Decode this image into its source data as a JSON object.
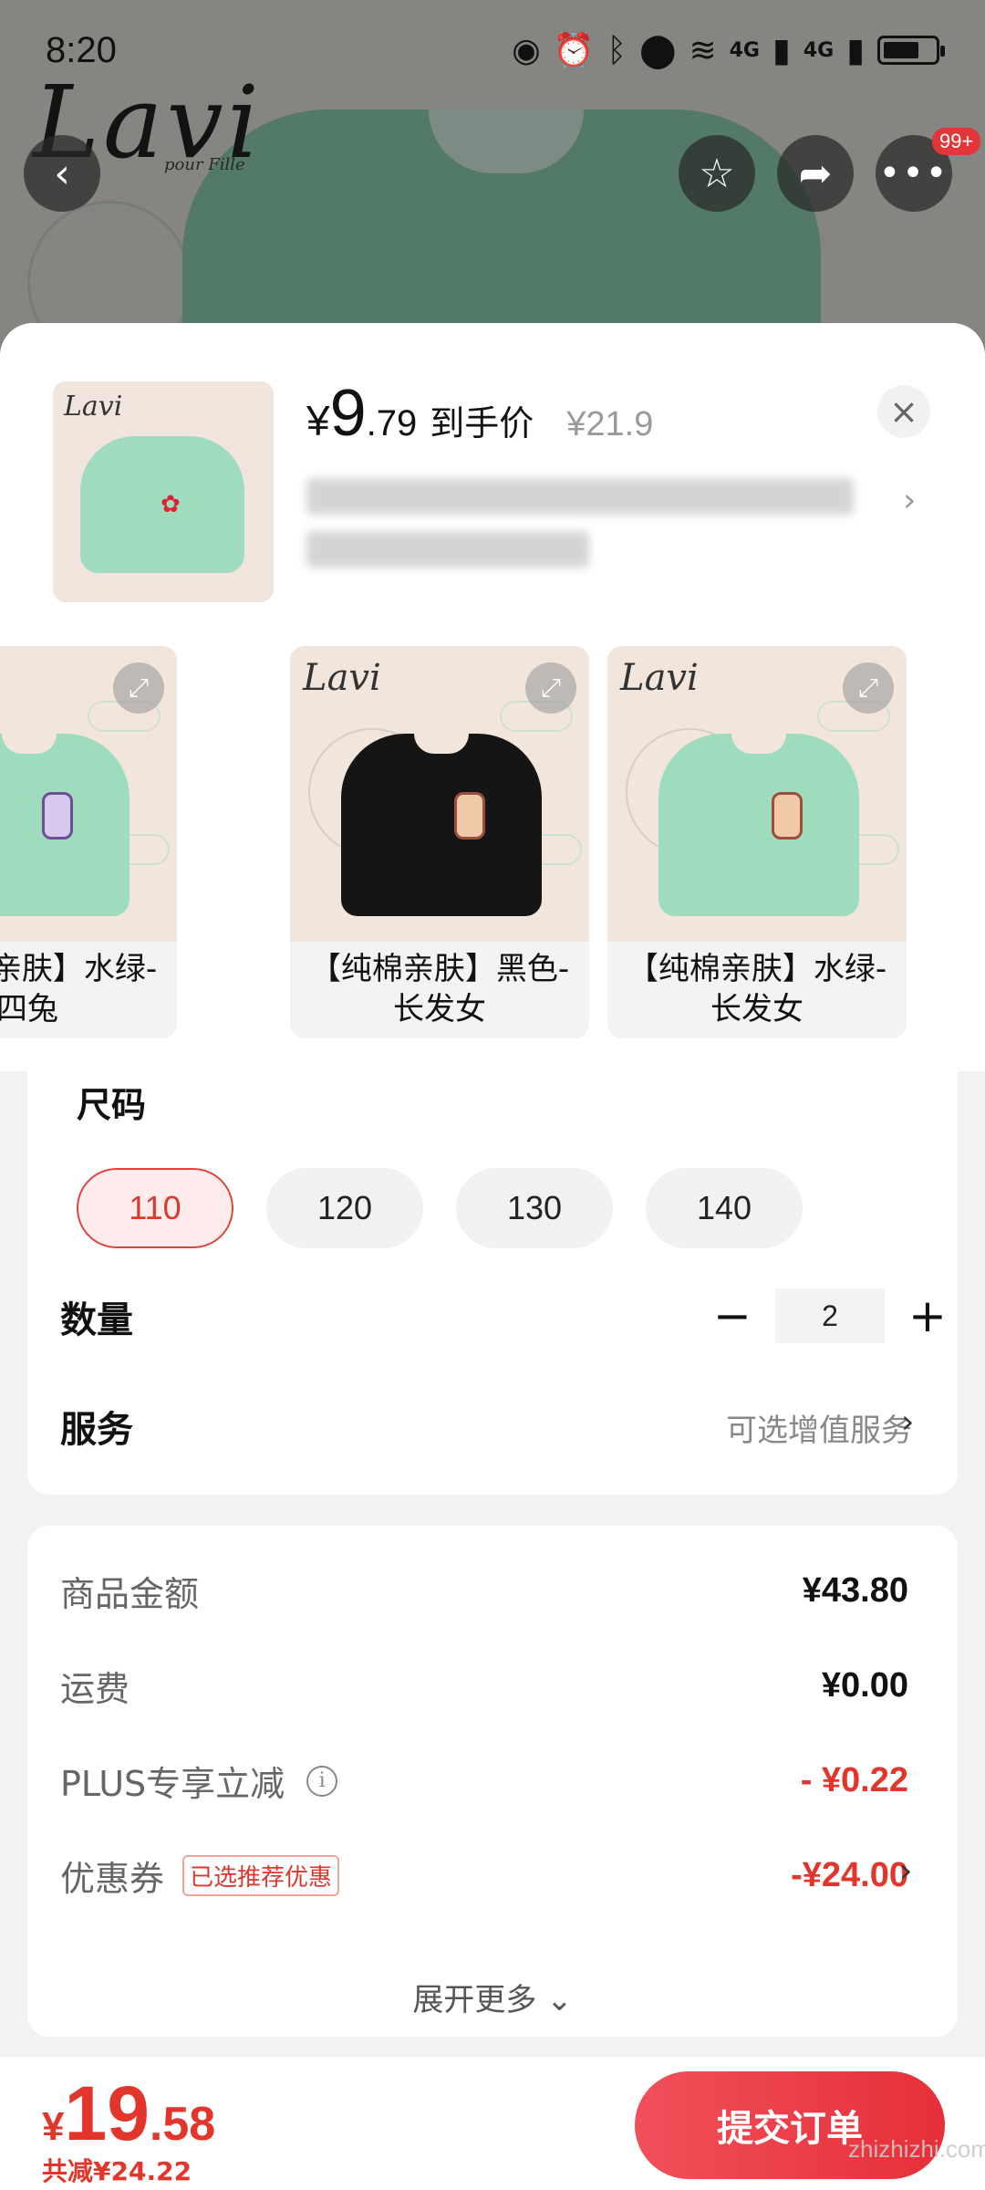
{
  "status_bar": {
    "time": "8:20",
    "network_1": "4G",
    "network_2": "4G"
  },
  "hero": {
    "brand_logo": "Lavi",
    "brand_sub": "pour Fille"
  },
  "top_actions": {
    "more_badge": "99+"
  },
  "product": {
    "price_yen": "¥",
    "price_int": "9",
    "price_dec": ".79",
    "price_tag": "到手价",
    "original_price": "¥21.9"
  },
  "variants": [
    {
      "label": "【纯棉亲肤】水绿-四兔",
      "color": "#9fdcbd"
    },
    {
      "label": "【纯棉亲肤】黑色-长发女",
      "color": "#151515"
    },
    {
      "label": "【纯棉亲肤】水绿-长发女",
      "color": "#9fdcbd"
    }
  ],
  "size": {
    "title": "尺码",
    "options": [
      "110",
      "120",
      "130",
      "140"
    ],
    "selected": "110"
  },
  "quantity": {
    "title": "数量",
    "value": "2",
    "minus": "−",
    "plus": "+"
  },
  "service": {
    "title": "服务",
    "link": "可选增值服务"
  },
  "summary": {
    "goods_label": "商品金额",
    "goods_value": "¥43.80",
    "shipping_label": "运费",
    "shipping_value": "¥0.00",
    "plus_label": "PLUS专享立减",
    "plus_value": "- ¥0.22",
    "coupon_label": "优惠券",
    "coupon_tag": "已选推荐优惠",
    "coupon_value": "-¥24.00",
    "expand_more": "展开更多"
  },
  "bottom": {
    "total_yen": "¥",
    "total_int": "19",
    "total_dec": ".58",
    "saved": "共减¥24.22",
    "submit": "提交订单"
  },
  "watermark": "zhizhizhi.com",
  "colors": {
    "accent": "#e2352c",
    "selected_bg": "#fdeceb"
  }
}
